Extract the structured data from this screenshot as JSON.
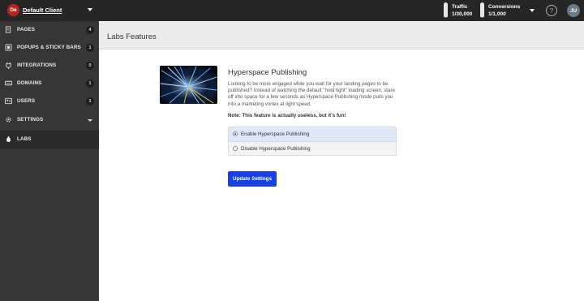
{
  "client": {
    "initials": "De",
    "name": "Default Client"
  },
  "usage": {
    "traffic": {
      "label": "Traffic",
      "value": "1/30,000",
      "fill_fraction": 0.05
    },
    "conversions": {
      "label": "Conversions",
      "value": "1/1,000",
      "fill_fraction": 0.05
    }
  },
  "header": {
    "help_symbol": "?",
    "user_initials": "JU"
  },
  "sidebar": {
    "items": [
      {
        "label": "PAGES",
        "badge": "4",
        "icon": "pages-icon"
      },
      {
        "label": "POPUPS & STICKY BARS",
        "badge": "1",
        "icon": "popups-icon"
      },
      {
        "label": "INTEGRATIONS",
        "badge": "0",
        "icon": "integrations-icon"
      },
      {
        "label": "DOMAINS",
        "badge": "1",
        "icon": "domains-icon"
      },
      {
        "label": "USERS",
        "badge": "1",
        "icon": "users-icon"
      },
      {
        "label": "SETTINGS",
        "badge": "",
        "icon": "settings-icon"
      },
      {
        "label": "LABS",
        "badge": "",
        "icon": "labs-icon"
      }
    ]
  },
  "page": {
    "title": "Labs Features"
  },
  "feature": {
    "title": "Hyperspace Publishing",
    "description": "Looking to be more engaged while you wait for your landing pages to be published? Instead of watching the default \"hold tight\" loading screen, stare off into space for a few seconds as Hyperspace Publishing mode pulls you into a marketing vortex at light speed.",
    "note": "Note: This feature is actually useless, but it's fun!",
    "options": [
      {
        "label": "Enable Hyperspace Publishing",
        "selected": true
      },
      {
        "label": "Disable Hyperspace Publishing",
        "selected": false
      }
    ],
    "button_label": "Update Settings"
  },
  "colors": {
    "accent": "#1741e6",
    "topbar": "#262626",
    "sidebar": "#363636",
    "client_avatar": "#b3261e"
  }
}
